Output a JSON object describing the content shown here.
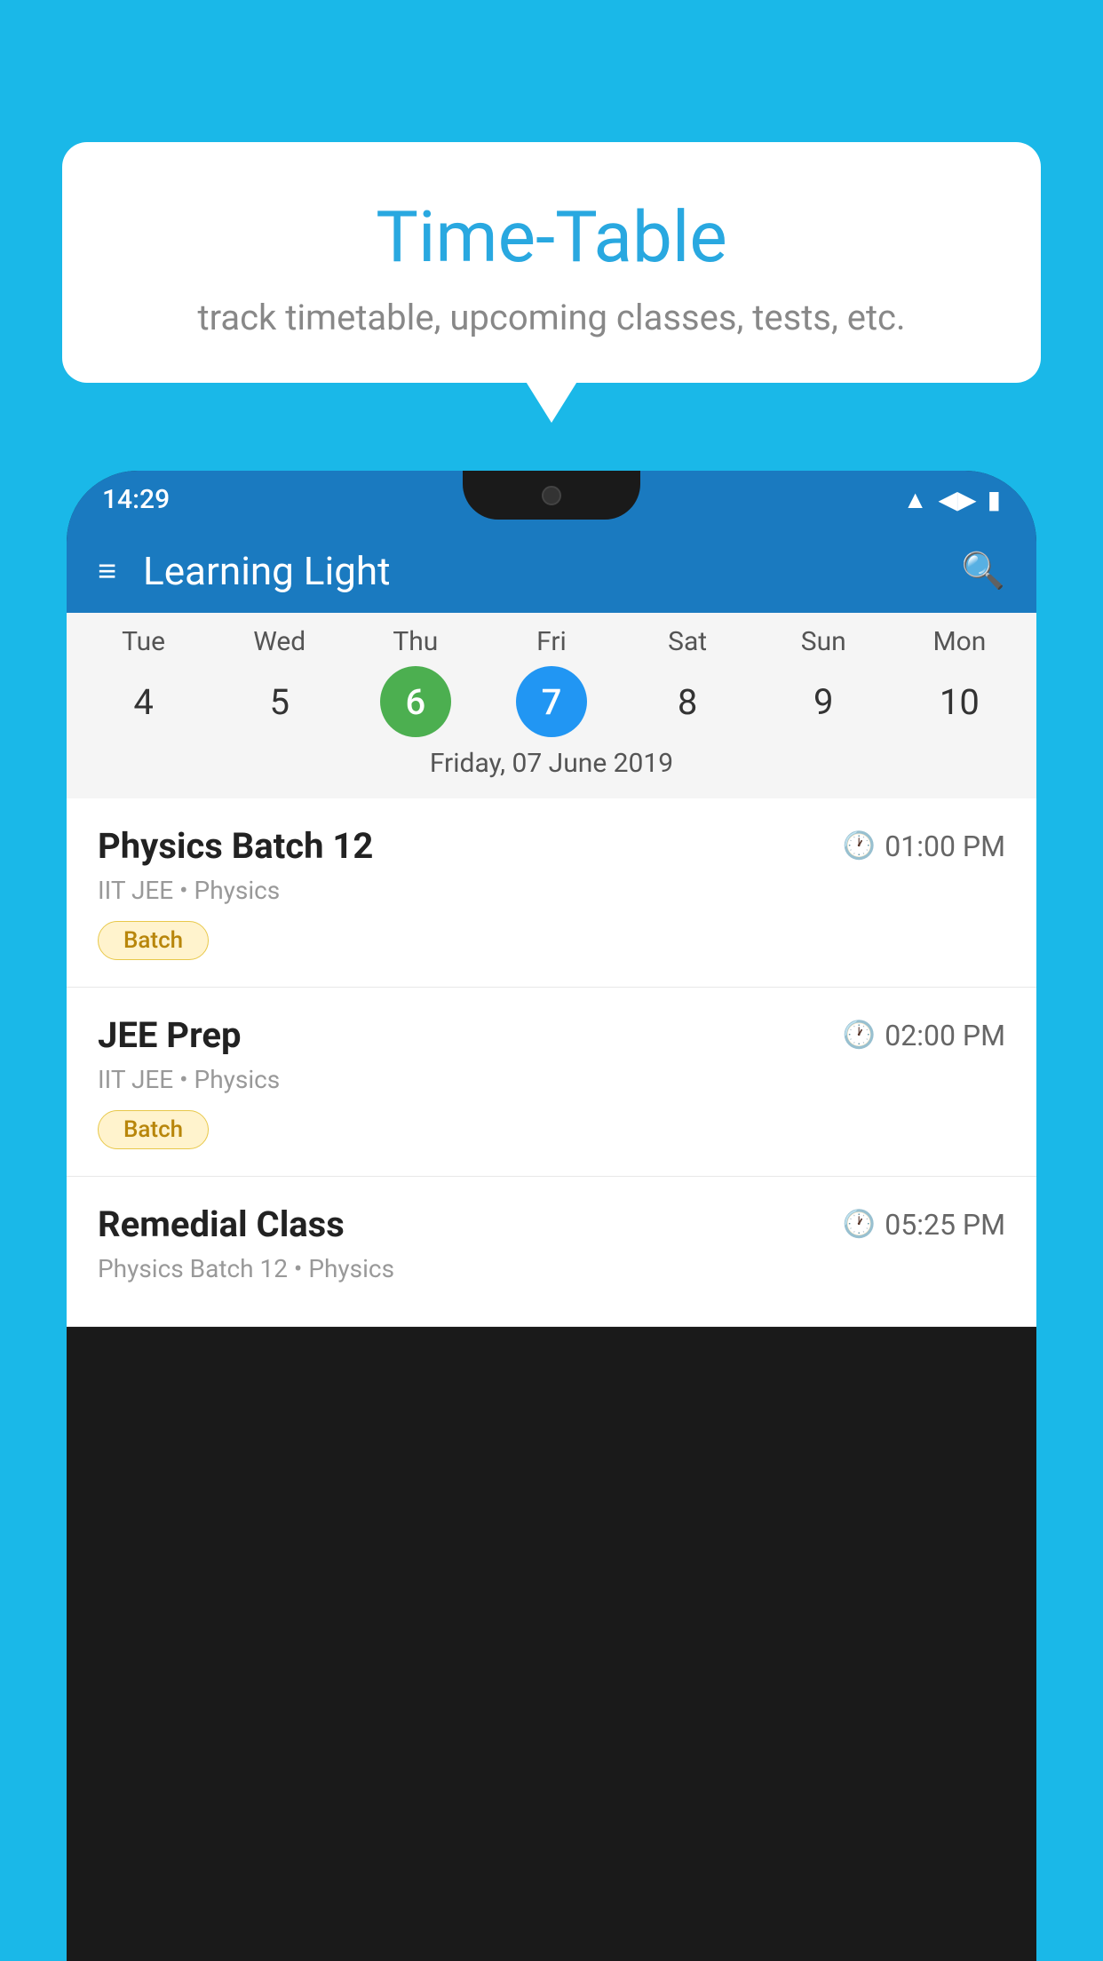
{
  "background_color": "#1ab8e8",
  "bubble": {
    "title": "Time-Table",
    "subtitle": "track timetable, upcoming classes, tests, etc."
  },
  "status_bar": {
    "time": "14:29"
  },
  "app_bar": {
    "title": "Learning Light"
  },
  "calendar": {
    "days": [
      {
        "name": "Tue",
        "num": "4"
      },
      {
        "name": "Wed",
        "num": "5"
      },
      {
        "name": "Thu",
        "num": "6",
        "state": "today"
      },
      {
        "name": "Fri",
        "num": "7",
        "state": "selected"
      },
      {
        "name": "Sat",
        "num": "8"
      },
      {
        "name": "Sun",
        "num": "9"
      },
      {
        "name": "Mon",
        "num": "10"
      }
    ],
    "selected_date_label": "Friday, 07 June 2019"
  },
  "schedule": [
    {
      "title": "Physics Batch 12",
      "time": "01:00 PM",
      "subtitle": "IIT JEE • Physics",
      "badge": "Batch"
    },
    {
      "title": "JEE Prep",
      "time": "02:00 PM",
      "subtitle": "IIT JEE • Physics",
      "badge": "Batch"
    },
    {
      "title": "Remedial Class",
      "time": "05:25 PM",
      "subtitle": "Physics Batch 12 • Physics",
      "badge": ""
    }
  ]
}
